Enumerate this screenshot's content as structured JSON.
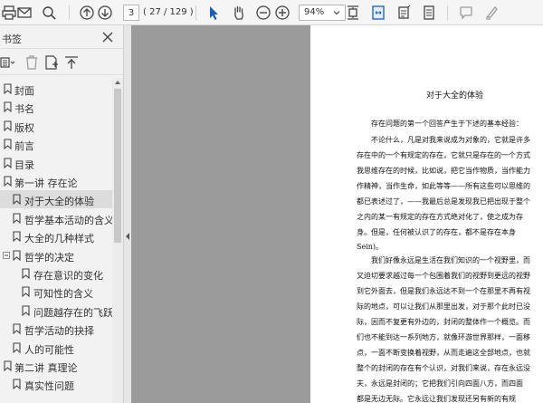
{
  "toolbar": {
    "page_current": "3",
    "page_total": "( 27 / 129 )",
    "zoom": "94%"
  },
  "sidebar": {
    "title": "书签",
    "items": [
      {
        "label": "封面"
      },
      {
        "label": "书名"
      },
      {
        "label": "版权"
      },
      {
        "label": "前言"
      },
      {
        "label": "目录"
      },
      {
        "label": "第一讲 存在论"
      },
      {
        "label": "对于大全的体验"
      },
      {
        "label": "哲学基本活动的含义"
      },
      {
        "label": "大全的几种样式"
      },
      {
        "label": "哲学的决定"
      },
      {
        "label": "存在意识的变化"
      },
      {
        "label": "可知性的含义"
      },
      {
        "label": "问题越存在的飞跃"
      },
      {
        "label": "哲学活动的抉择"
      },
      {
        "label": "人的可能性"
      },
      {
        "label": "第二讲 真理论"
      },
      {
        "label": "真实性问题"
      }
    ]
  },
  "page": {
    "title": "对于大全的体验",
    "lines": [
      "存在问题的第一个回答产生于下述的基本经验：",
      "不论什么，凡是对我来说成为对象的，它就是许多",
      "存在中的一个有规定的存在，它就只是存在的一个方式",
      "我思维存在的时候，比如说，把它当作物质，当作能力",
      "作精神，当作生命，如此等等——所有这些可以思维的",
      "都已表述过了，——我最后总是发现我已把出现于整个",
      "之内的某一有规定的存在方式绝对化了，使之成为存",
      "身。但是，任何被认识了的存在，都不是存在本身",
      "Sein)。",
      "我们好像永远是生活在我们知识的一个视野里，而",
      "又迫切要求越过每一个包围着我们的视野到更远的视野",
      "到它外面去，但是我们永远达不到一个在那里不再有视",
      "际的地点，可以让我们从那里出发，对于那个此时已没",
      "际，因而不复更有外边的，封闭的整体作一个概览。而",
      "们也不能到达一系列地方，就像环游世界那样，一面移",
      "点，一面不断变换着视野，从而走遍这全部地点，也就",
      "整个的封闭的存在有个认识，对我们来说，存在永远没",
      "夫，永远是封闭的；它把我们引向四面八方，而四面",
      "都是无边无际。它永远让我们发现还另有新的有规"
    ]
  }
}
